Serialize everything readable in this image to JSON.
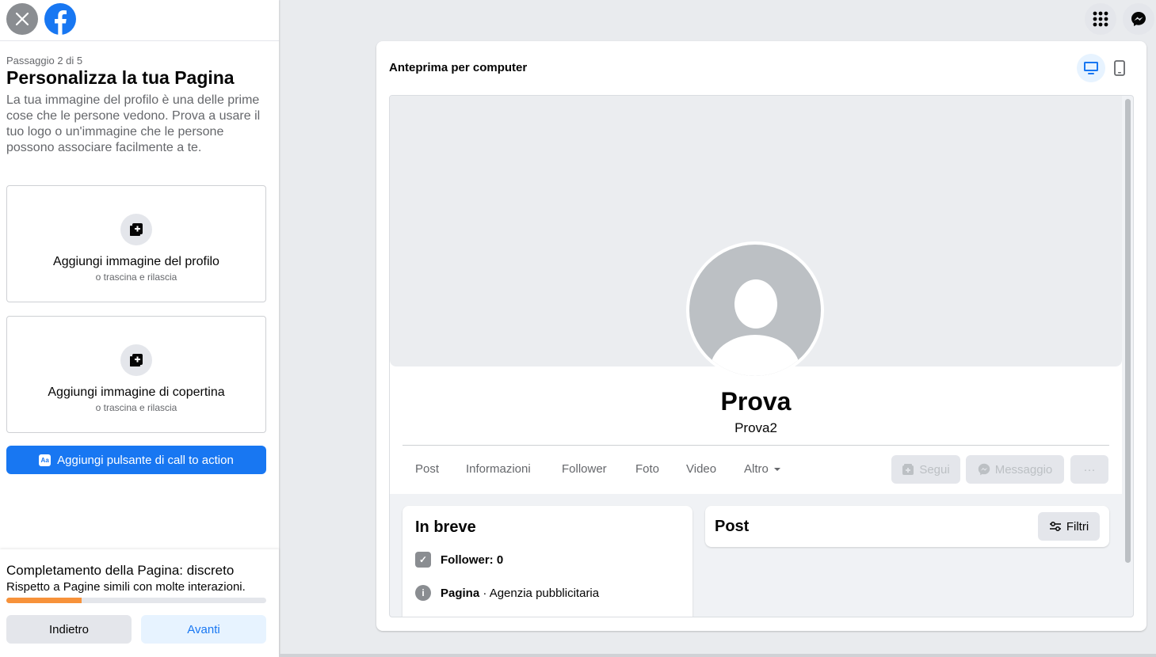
{
  "left_panel": {
    "step": "Passaggio 2 di 5",
    "title": "Personalizza la tua Pagina",
    "description": "La tua immagine del profilo è una delle prime cose che le persone vedono. Prova a usare il tuo logo o un'immagine che le persone possono associare facilmente a te.",
    "profile_upload": {
      "label": "Aggiungi immagine del profilo",
      "sub": "o trascina e rilascia"
    },
    "cover_upload": {
      "label": "Aggiungi immagine di copertina",
      "sub": "o trascina e rilascia"
    },
    "cta_button": {
      "icon_text": "Aa",
      "label": "Aggiungi pulsante di call to action"
    },
    "completion": {
      "title": "Completamento della Pagina: discreto",
      "subtitle": "Rispetto a Pagine simili con molte interazioni.",
      "progress_fraction": 0.29
    },
    "back_label": "Indietro",
    "next_label": "Avanti"
  },
  "preview": {
    "title": "Anteprima per computer",
    "page_name": "Prova",
    "username": "Prova2",
    "tabs": [
      "Post",
      "Informazioni",
      "Follower",
      "Foto",
      "Video",
      "Altro"
    ],
    "follow_label": "Segui",
    "message_label": "Messaggio",
    "more_label": "···",
    "intro": {
      "title": "In breve",
      "followers": "Follower: 0",
      "category_bold": "Pagina",
      "category_rest": " · Agenzia pubblicitaria"
    },
    "posts": {
      "title": "Post",
      "filter_label": "Filtri"
    }
  },
  "colors": {
    "brand": "#1877f2",
    "progress": "#f7923a"
  }
}
